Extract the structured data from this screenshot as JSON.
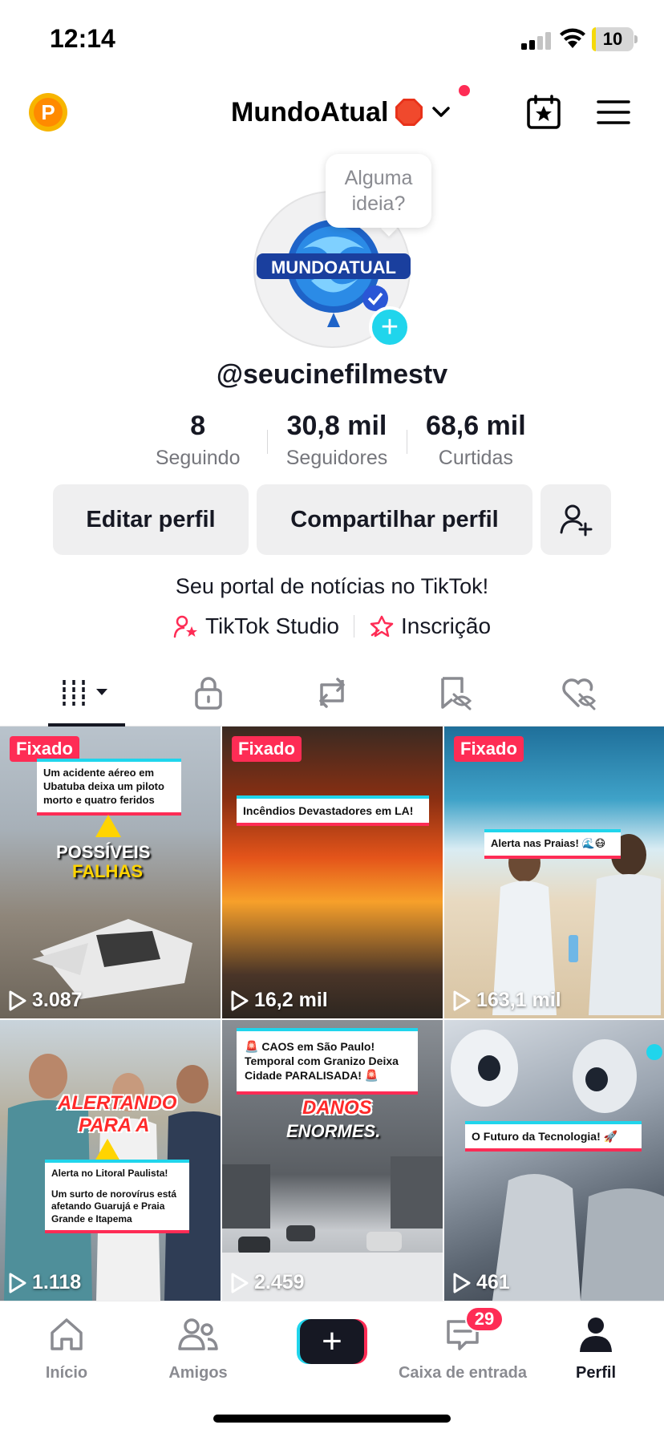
{
  "status_bar": {
    "time": "12:14",
    "battery": "10",
    "battery_level": 0.1
  },
  "header": {
    "coin_letter": "P",
    "account_name": "MundoAtual",
    "account_emoji": "stop-sign",
    "icons": [
      "calendar-star-icon",
      "hamburger-menu-icon"
    ]
  },
  "profile": {
    "tooltip": "Alguma ideia?",
    "avatar_text": "MUNDOATUAL",
    "username": "@seucinefilmestv",
    "stats": [
      {
        "value": "8",
        "label": "Seguindo"
      },
      {
        "value": "30,8 mil",
        "label": "Seguidores"
      },
      {
        "value": "68,6 mil",
        "label": "Curtidas"
      }
    ],
    "buttons": {
      "edit": "Editar perfil",
      "share": "Compartilhar perfil"
    },
    "bio": "Seu portal de notícias no TikTok!",
    "links": [
      {
        "label": "TikTok Studio",
        "icon": "person-star-icon"
      },
      {
        "label": "Inscrição",
        "icon": "subscription-star-icon"
      }
    ]
  },
  "tabs": [
    "videos-grid-tab",
    "private-tab",
    "reposts-tab",
    "favorites-tab",
    "liked-tab"
  ],
  "videos": [
    {
      "pinned": "Fixado",
      "caption": "Um acidente aéreo em Ubatuba deixa um piloto morto e quatro feridos",
      "headline_1": "POSSÍVEIS",
      "headline_2": "FALHAS",
      "views": "3.087"
    },
    {
      "pinned": "Fixado",
      "caption": "Incêndios Devastadores em LA!",
      "views": "16,2 mil"
    },
    {
      "pinned": "Fixado",
      "caption": "Alerta nas Praias! 🌊😷",
      "views": "163,1 mil"
    },
    {
      "headline_1": "ALERTANDO",
      "headline_2": "PARA A",
      "caption_title": "Alerta no Litoral Paulista!",
      "caption": "Um surto de norovírus está afetando Guarujá e Praia Grande e Itapema",
      "views": "1.118"
    },
    {
      "caption": "🚨 CAOS em São Paulo! Temporal com Granizo Deixa Cidade PARALISADA! 🚨",
      "headline_1": "DANOS",
      "headline_2": "ENORMES.",
      "views": "2.459"
    },
    {
      "caption": "O Futuro da Tecnologia! 🚀",
      "views": "461"
    }
  ],
  "bottom_nav": {
    "home": "Início",
    "friends": "Amigos",
    "inbox": "Caixa de entrada",
    "inbox_badge": "29",
    "profile": "Perfil"
  },
  "colors": {
    "accent_red": "#fe2c55",
    "accent_cyan": "#20d5ec",
    "text": "#161823"
  }
}
